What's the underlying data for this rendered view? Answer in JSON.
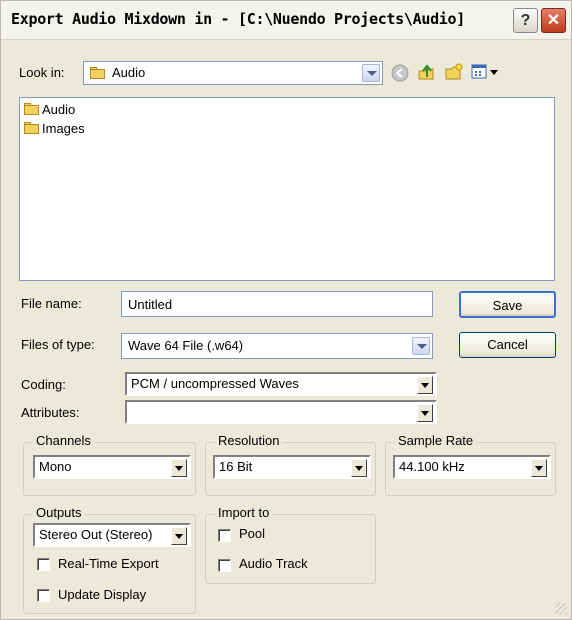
{
  "window": {
    "title": "Export Audio Mixdown in - [C:\\Nuendo Projects\\Audio]",
    "help_label": "?",
    "close_label": "✕"
  },
  "lookin": {
    "label": "Look in:",
    "value": "Audio"
  },
  "files": [
    {
      "name": "Audio"
    },
    {
      "name": "Images"
    }
  ],
  "filename": {
    "label": "File name:",
    "value": "Untitled"
  },
  "filetype": {
    "label": "Files of type:",
    "value": "Wave 64 File (.w64)"
  },
  "buttons": {
    "save": "Save",
    "cancel": "Cancel"
  },
  "coding": {
    "label": "Coding:",
    "value": "PCM / uncompressed Waves"
  },
  "attributes": {
    "label": "Attributes:",
    "value": ""
  },
  "channels": {
    "title": "Channels",
    "value": "Mono"
  },
  "resolution": {
    "title": "Resolution",
    "value": "16 Bit"
  },
  "samplerate": {
    "title": "Sample Rate",
    "value": "44.100 kHz"
  },
  "outputs": {
    "title": "Outputs",
    "value": "Stereo Out (Stereo)",
    "realtime_label": "Real-Time Export",
    "update_label": "Update Display"
  },
  "importto": {
    "title": "Import to",
    "pool_label": "Pool",
    "audiotrack_label": "Audio Track"
  },
  "colors": {
    "dialog_bg": "#ece9d8",
    "folder": "#f2d25c",
    "close_red": "#c03a1c",
    "xp_border": "#7f9db9"
  }
}
